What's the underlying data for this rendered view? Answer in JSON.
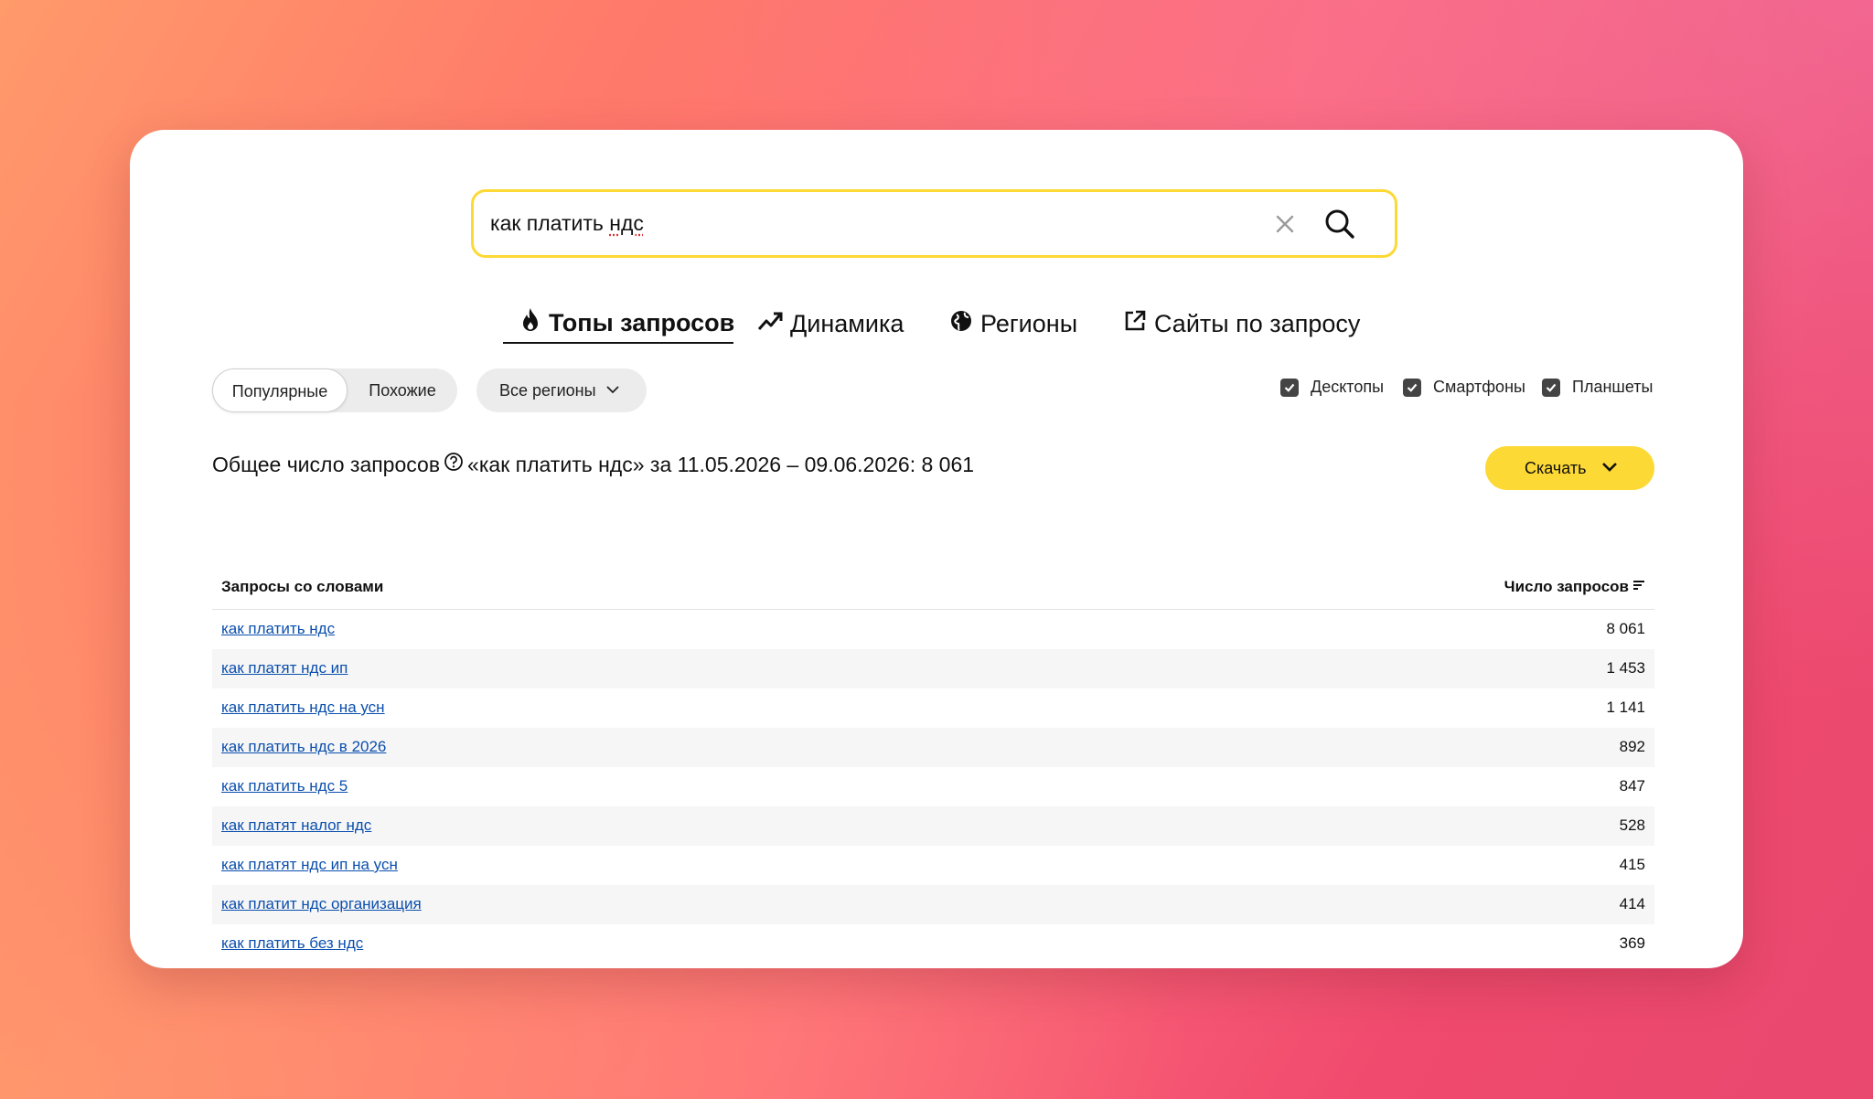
{
  "colors": {
    "accent": "#fdd935",
    "link": "#0b4fae",
    "text": "#111111"
  },
  "search": {
    "value_prefix": "как платить ",
    "value_spell": "ндс",
    "clear_icon": "close-icon",
    "search_icon": "search-icon"
  },
  "tabs": [
    {
      "label": "Топы запросов",
      "icon": "fire-icon",
      "active": true
    },
    {
      "label": "Динамика",
      "icon": "trend-up-icon",
      "active": false
    },
    {
      "label": "Регионы",
      "icon": "globe-icon",
      "active": false
    },
    {
      "label": "Сайты по запросу",
      "icon": "external-link-icon",
      "active": false
    }
  ],
  "filters": {
    "segment": [
      {
        "label": "Популярные",
        "active": true
      },
      {
        "label": "Похожие",
        "active": false
      }
    ],
    "region": "Все регионы",
    "devices": [
      {
        "label": "Десктопы",
        "checked": true
      },
      {
        "label": "Смартфоны",
        "checked": true
      },
      {
        "label": "Планшеты",
        "checked": true
      }
    ]
  },
  "summary": {
    "prefix": "Общее число запросов",
    "suffix": "«как платить ндс» за 11.05.2026 – 09.06.2026: 8 061"
  },
  "download": {
    "label": "Скачать"
  },
  "table": {
    "col_query": "Запросы со словами",
    "col_count": "Число запросов",
    "rows": [
      {
        "query": "как платить ндс",
        "count": "8 061"
      },
      {
        "query": "как платят ндс ип",
        "count": "1 453"
      },
      {
        "query": "как платить ндс на усн",
        "count": "1 141"
      },
      {
        "query": "как платить ндс в 2026",
        "count": "892"
      },
      {
        "query": "как платить ндс 5",
        "count": "847"
      },
      {
        "query": "как платят налог ндс",
        "count": "528"
      },
      {
        "query": "как платят ндс ип на усн",
        "count": "415"
      },
      {
        "query": "как платит ндс организация",
        "count": "414"
      },
      {
        "query": "как платить без ндс",
        "count": "369"
      }
    ]
  }
}
